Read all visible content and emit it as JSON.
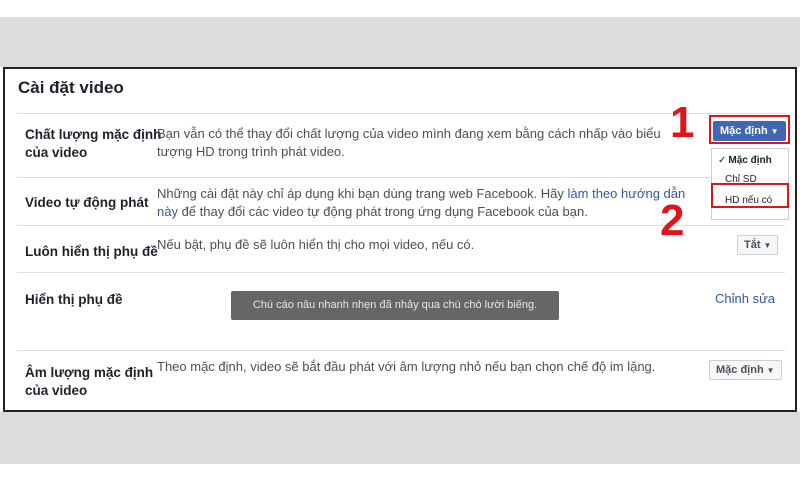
{
  "page": {
    "title": "Cài đặt video"
  },
  "rows": [
    {
      "label": [
        "Chất lượng mặc định",
        "của video"
      ],
      "description_lines": [
        "Bạn vẫn có thể thay đổi chất lượng của video mình đang xem bằng cách nhấp vào biểu",
        "tượng HD trong trình phát video."
      ],
      "control": "Mặc định"
    },
    {
      "label": [
        "Video tự động phát"
      ],
      "description_line1": "Những cài đặt này chỉ áp dụng khi bạn dùng trang web Facebook. Hãy ",
      "description_link_a": "làm theo hướng dẫn",
      "description_link_b": "này",
      "description_line2_rest": " để thay đổi các video tự động phát trong ứng dụng Facebook của bạn."
    },
    {
      "label": [
        "Luôn hiển thị phụ đề"
      ],
      "description": "Nếu bật, phụ đề sẽ luôn hiển thị cho mọi video, nếu có.",
      "control": "Tắt"
    },
    {
      "label": [
        "Hiển thị phụ đề"
      ],
      "preview_text": "Chú cáo nâu nhanh nhẹn đã nhảy qua chú chó lười biếng.",
      "control": "Chỉnh sửa"
    },
    {
      "label": [
        "Âm lượng mặc định",
        "của video"
      ],
      "description": "Theo mặc định, video sẽ bắt đầu phát với âm lượng nhỏ nếu bạn chọn chế độ im lặng.",
      "control": "Mặc định"
    }
  ],
  "quality_menu": {
    "items": [
      "Mặc định",
      "Chỉ SD",
      "HD nếu có"
    ],
    "selected": "Mặc định",
    "check_glyph": "✓"
  },
  "annotations": {
    "step1": "1",
    "step2": "2",
    "color": "#e0141b"
  },
  "colors": {
    "primary": "#4267b2",
    "link": "#365899",
    "highlight": "#e0141b"
  }
}
